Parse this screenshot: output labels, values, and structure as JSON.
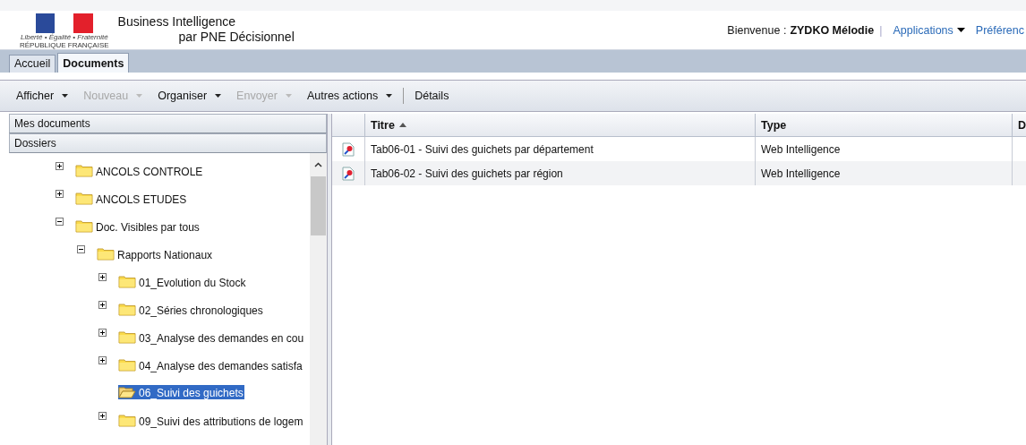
{
  "header": {
    "logo_motto": "Liberté • Égalité • Fraternité",
    "logo_caption": "RÉPUBLIQUE FRANÇAISE",
    "title": "Business Intelligence",
    "subtitle": "par PNE Décisionnel",
    "welcome_label": "Bienvenue :",
    "user_name": "ZYDKO Mélodie",
    "separator": "|",
    "links": [
      {
        "label": "Applications",
        "dropdown": true
      },
      {
        "label": "Préférenc",
        "dropdown": false
      }
    ]
  },
  "tabs": [
    {
      "label": "Accueil",
      "selected": false
    },
    {
      "label": "Documents",
      "selected": true
    }
  ],
  "toolbar": [
    {
      "label": "Afficher",
      "disabled": false,
      "dropdown": true
    },
    {
      "label": "Nouveau",
      "disabled": true,
      "dropdown": true
    },
    {
      "label": "Organiser",
      "disabled": false,
      "dropdown": true
    },
    {
      "label": "Envoyer",
      "disabled": true,
      "dropdown": true
    },
    {
      "label": "Autres actions",
      "disabled": false,
      "dropdown": true
    },
    {
      "label": "Détails",
      "disabled": false,
      "dropdown": false
    }
  ],
  "sidebar": {
    "sections": [
      {
        "label": "Mes documents"
      },
      {
        "label": "Dossiers"
      }
    ],
    "tree": [
      {
        "label": "ANCOLS CONTROLE",
        "expandable": true,
        "selected": false
      },
      {
        "label": "ANCOLS ETUDES",
        "expandable": true,
        "selected": false
      },
      {
        "label": "Doc. Visibles par tous",
        "expandable": true,
        "expanded": true,
        "selected": false,
        "children": [
          {
            "label": "Rapports Nationaux",
            "expandable": true,
            "expanded": true,
            "selected": false,
            "children": [
              {
                "label": "01_Evolution du Stock",
                "expandable": true,
                "selected": false
              },
              {
                "label": "02_Séries chronologiques",
                "expandable": true,
                "selected": false
              },
              {
                "label": "03_Analyse des demandes en cou",
                "expandable": true,
                "selected": false
              },
              {
                "label": "04_Analyse des demandes satisfa",
                "expandable": true,
                "selected": false
              },
              {
                "label": "06_Suivi des guichets",
                "expandable": false,
                "selected": true
              },
              {
                "label": "09_Suivi des attributions de logem",
                "expandable": true,
                "selected": false
              }
            ]
          }
        ]
      }
    ]
  },
  "table": {
    "columns": [
      {
        "label": "Titre",
        "sorted": true
      },
      {
        "label": "Type",
        "sorted": false
      },
      {
        "label": "D",
        "sorted": false
      }
    ],
    "rows": [
      {
        "title": "Tab06-01 - Suivi des guichets par département",
        "type": "Web Intelligence"
      },
      {
        "title": "Tab06-02 - Suivi des guichets par région",
        "type": "Web Intelligence"
      }
    ]
  }
}
